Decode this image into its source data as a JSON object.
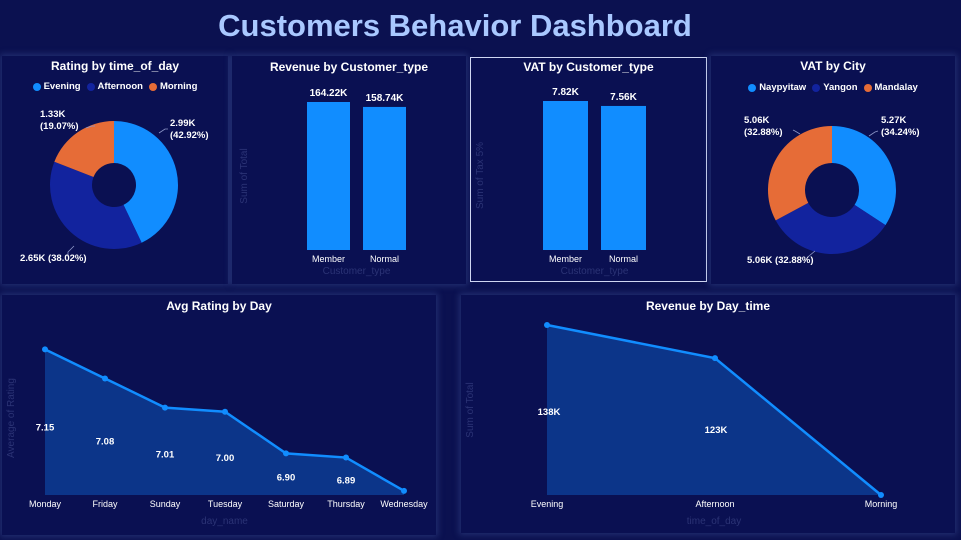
{
  "dashboard": {
    "title": "Customers Behavior Dashboard"
  },
  "colors": {
    "blue": "#118dff",
    "navy": "#12239e",
    "orange": "#e66c37",
    "area": "#0c3a8f",
    "axis_text": "#ffffff",
    "faint_text": "#2b3375"
  },
  "chart_data": [
    {
      "id": "rating_by_time",
      "type": "pie",
      "title": "Rating by time_of_day",
      "legend": [
        "Evening",
        "Afternoon",
        "Morning"
      ],
      "slices": [
        {
          "name": "Evening",
          "value": 2990,
          "label": "2.99K",
          "pct": "(42.92%)",
          "color": "#118dff"
        },
        {
          "name": "Afternoon",
          "value": 2650,
          "label": "2.65K (38.02%)",
          "pct": "",
          "color": "#12239e"
        },
        {
          "name": "Morning",
          "value": 1330,
          "label": "1.33K",
          "pct": "(19.07%)",
          "color": "#e66c37"
        }
      ]
    },
    {
      "id": "revenue_by_customer",
      "type": "bar",
      "title": "Revenue by Customer_type",
      "xlabel": "Customer_type",
      "ylabel": "Sum of Total",
      "categories": [
        "Member",
        "Normal"
      ],
      "values": [
        164220,
        158740
      ],
      "data_labels": [
        "164.22K",
        "158.74K"
      ],
      "ylim": [
        0,
        164220
      ]
    },
    {
      "id": "vat_by_customer",
      "type": "bar",
      "title": "VAT by Customer_type",
      "xlabel": "Customer_type",
      "ylabel": "Sum of Tax 5%",
      "categories": [
        "Member",
        "Normal"
      ],
      "values": [
        7820,
        7560
      ],
      "data_labels": [
        "7.82K",
        "7.56K"
      ],
      "ylim": [
        0,
        7820
      ]
    },
    {
      "id": "vat_by_city",
      "type": "pie",
      "title": "VAT by City",
      "legend": [
        "Naypyitaw",
        "Yangon",
        "Mandalay"
      ],
      "slices": [
        {
          "name": "Naypyitaw",
          "value": 5270,
          "label": "5.27K",
          "pct": "(34.24%)",
          "color": "#118dff"
        },
        {
          "name": "Yangon",
          "value": 5060,
          "label": "5.06K (32.88%)",
          "pct": "",
          "color": "#12239e"
        },
        {
          "name": "Mandalay",
          "value": 5060,
          "label": "5.06K",
          "pct": "(32.88%)",
          "color": "#e66c37"
        }
      ]
    },
    {
      "id": "avg_rating_by_day",
      "type": "area",
      "title": "Avg Rating by Day",
      "xlabel": "day_name",
      "ylabel": "Average of Rating",
      "categories": [
        "Monday",
        "Friday",
        "Sunday",
        "Tuesday",
        "Saturday",
        "Thursday",
        "Wednesday"
      ],
      "values": [
        7.15,
        7.08,
        7.01,
        7.0,
        6.9,
        6.89,
        6.81
      ],
      "data_labels": [
        "7.15",
        "7.08",
        "7.01",
        "7.00",
        "6.90",
        "6.89",
        ""
      ],
      "ylim": [
        6.8,
        7.17
      ]
    },
    {
      "id": "revenue_by_daytime",
      "type": "area",
      "title": "Revenue by Day_time",
      "xlabel": "time_of_day",
      "ylabel": "Sum of Total",
      "categories": [
        "Evening",
        "Afternoon",
        "Morning"
      ],
      "values": [
        138000,
        123000,
        61000
      ],
      "data_labels": [
        "138K",
        "123K",
        ""
      ],
      "ylim": [
        61000,
        138000
      ]
    }
  ]
}
